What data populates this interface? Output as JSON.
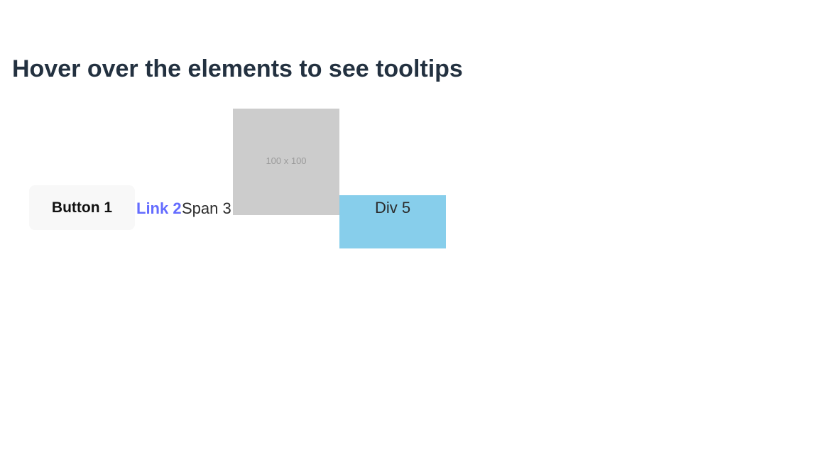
{
  "page": {
    "heading": "Hover over the elements to see tooltips"
  },
  "elements": {
    "button_label": "Button 1",
    "link_label": "Link 2",
    "span_label": "Span 3",
    "image_placeholder_text": "100 x 100",
    "div_label": "Div 5"
  },
  "colors": {
    "heading": "#233140",
    "button_bg": "#f8f8f8",
    "link": "#646cff",
    "image_bg": "#cccccc",
    "div_bg": "#87ceeb"
  }
}
